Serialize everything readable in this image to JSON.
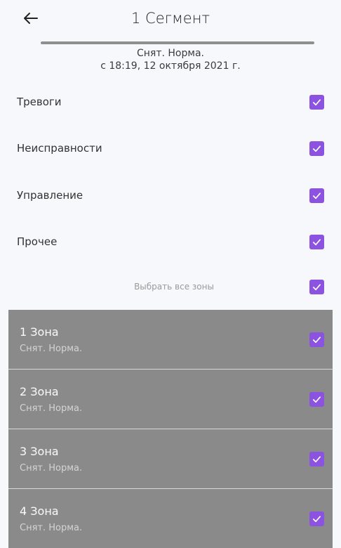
{
  "header": {
    "title": "1 Сегмент",
    "back_icon": "arrow-left-icon"
  },
  "status": {
    "state": "Снят. Норма.",
    "since": "с 18:19, 12 октября 2021 г."
  },
  "filters": [
    {
      "label": "Тревоги",
      "checked": true
    },
    {
      "label": "Неисправности",
      "checked": true
    },
    {
      "label": "Управление",
      "checked": true
    },
    {
      "label": "Прочее",
      "checked": true
    }
  ],
  "select_all": {
    "label": "Выбрать все зоны",
    "checked": true
  },
  "zones": [
    {
      "name": "1 Зона",
      "state": "Снят. Норма.",
      "checked": true
    },
    {
      "name": "2 Зона",
      "state": "Снят. Норма.",
      "checked": true
    },
    {
      "name": "3 Зона",
      "state": "Снят. Норма.",
      "checked": true
    },
    {
      "name": "4 Зона",
      "state": "Снят. Норма.",
      "checked": true
    }
  ],
  "colors": {
    "accent": "#8c52e0",
    "zone_bg": "#8a8a8a",
    "page_bg": "#f7f8fc"
  }
}
